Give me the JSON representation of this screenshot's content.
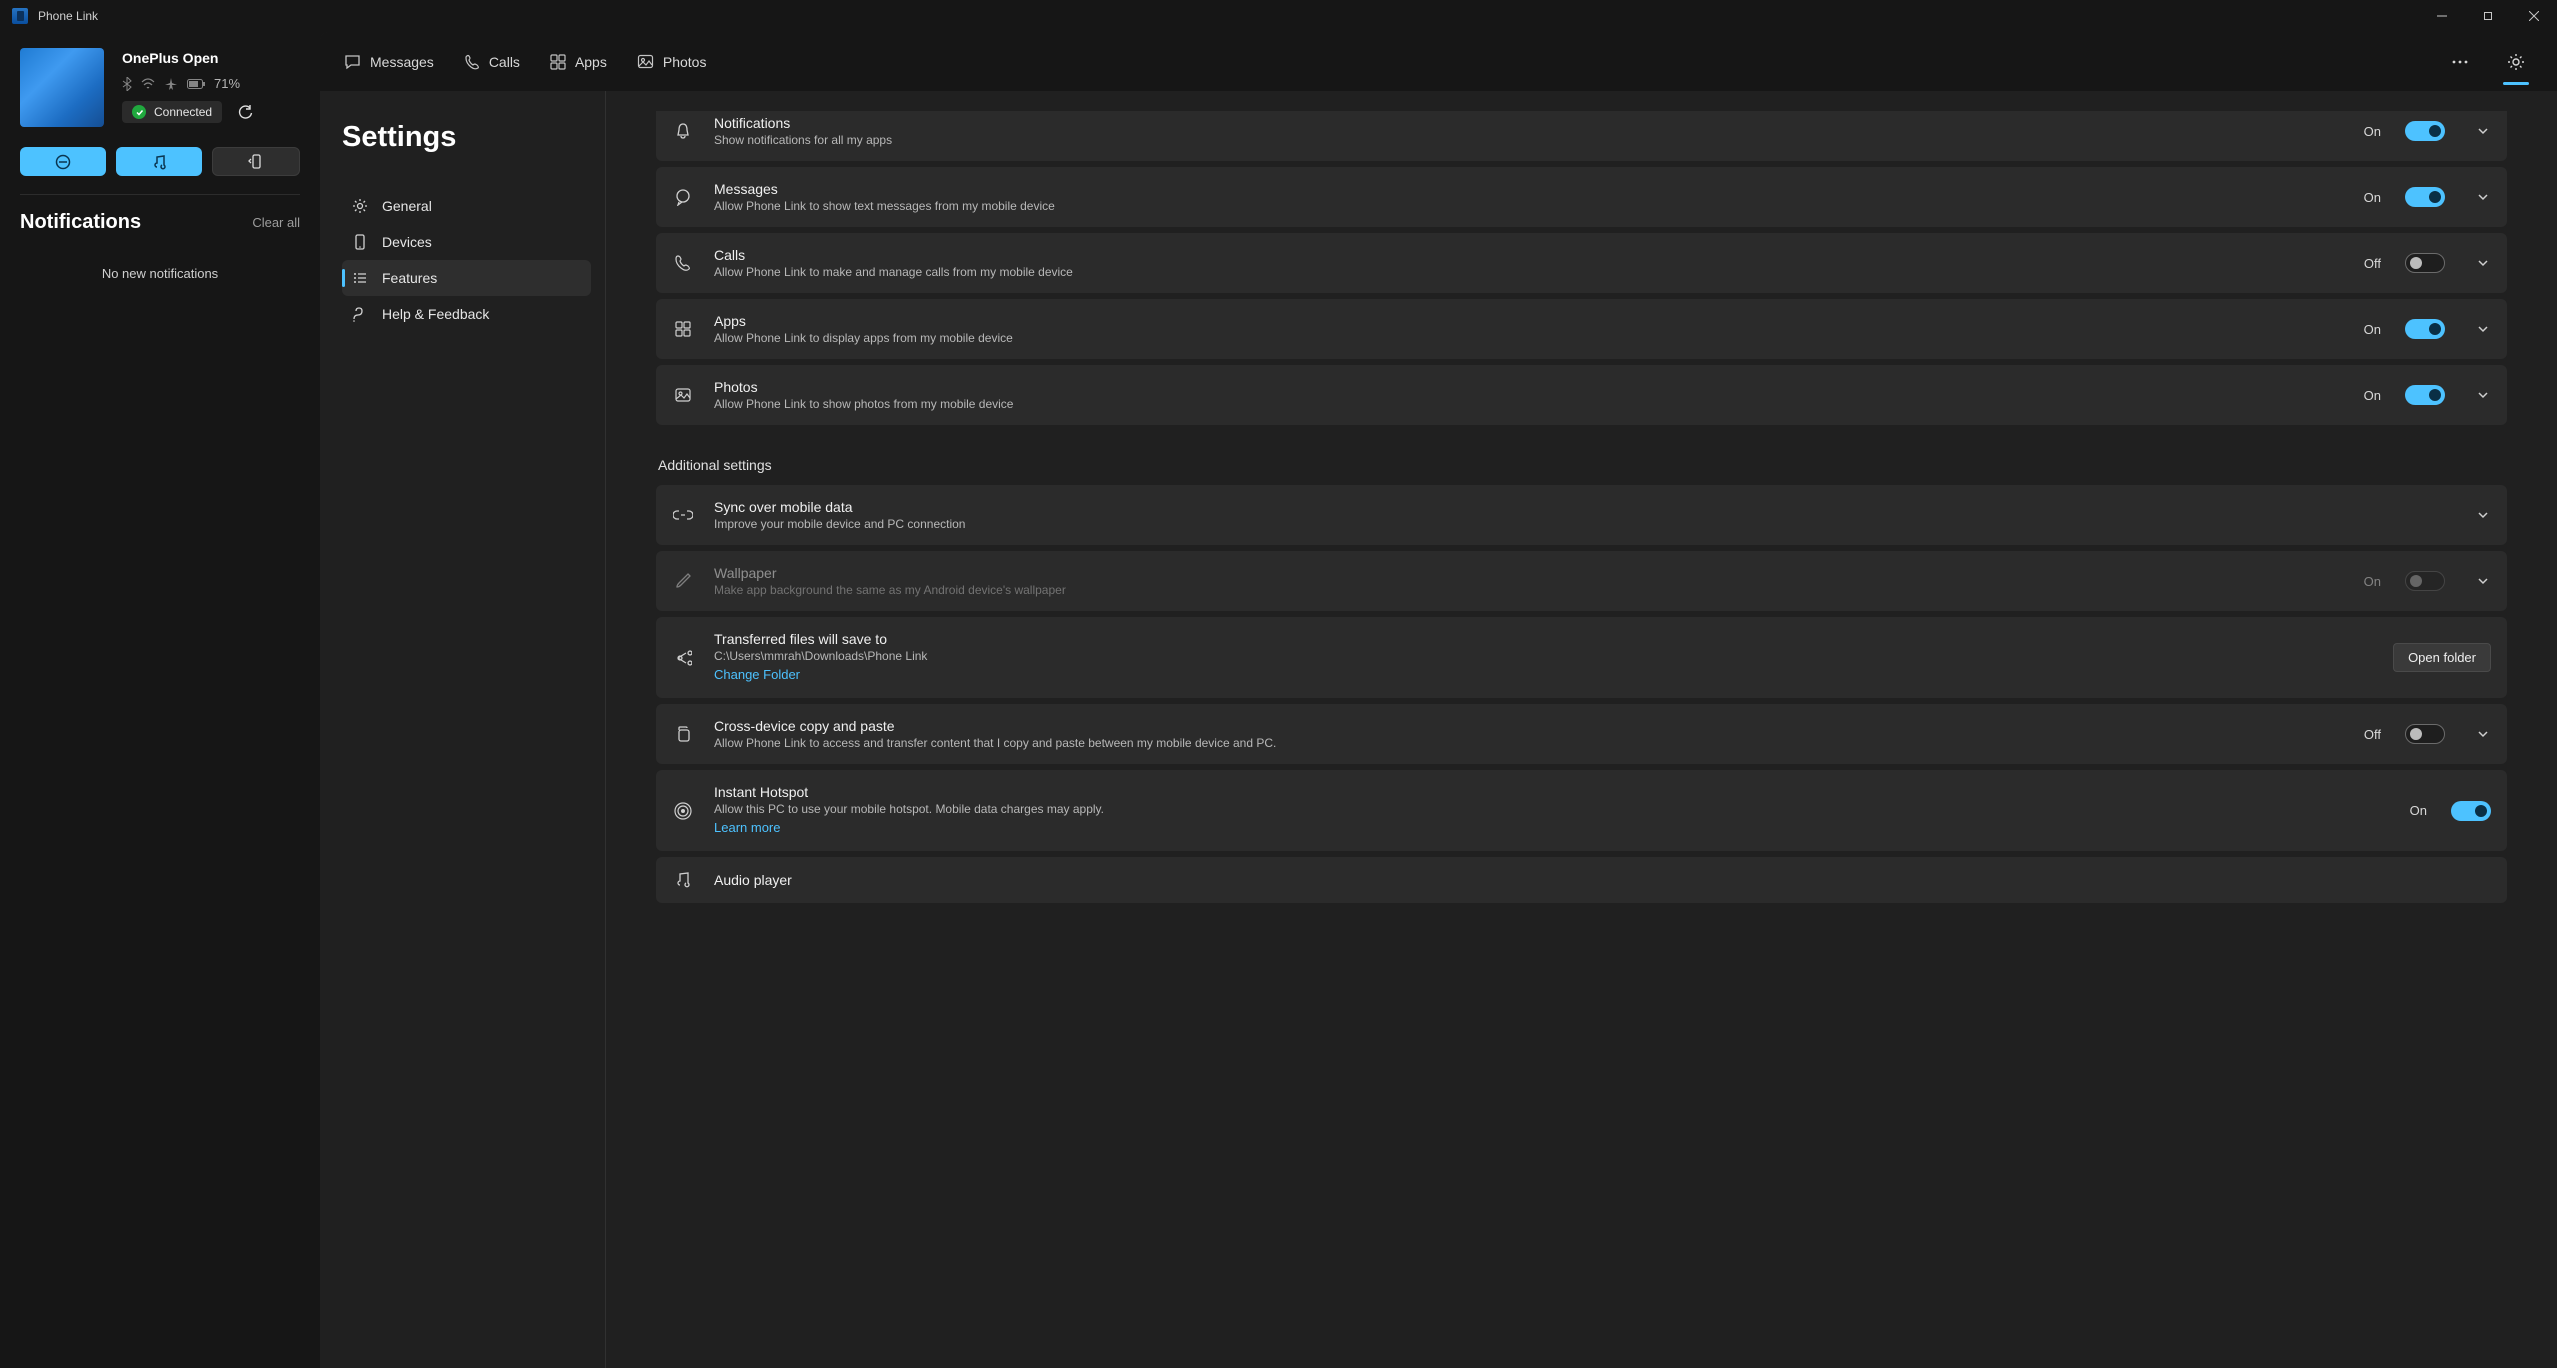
{
  "app": {
    "title": "Phone Link"
  },
  "device": {
    "name": "OnePlus Open",
    "battery": "71%",
    "status_label": "Connected"
  },
  "sidebar": {
    "notifications_heading": "Notifications",
    "clear_all": "Clear all",
    "empty_text": "No new notifications"
  },
  "nav": {
    "messages": "Messages",
    "calls": "Calls",
    "apps": "Apps",
    "photos": "Photos"
  },
  "settings": {
    "title": "Settings",
    "items": [
      {
        "label": "General"
      },
      {
        "label": "Devices"
      },
      {
        "label": "Features"
      },
      {
        "label": "Help & Feedback"
      }
    ],
    "additional_label": "Additional settings",
    "rows": {
      "notifications": {
        "title": "Notifications",
        "sub": "Show notifications for all my apps",
        "state": "On"
      },
      "messages": {
        "title": "Messages",
        "sub": "Allow Phone Link to show text messages from my mobile device",
        "state": "On"
      },
      "calls": {
        "title": "Calls",
        "sub": "Allow Phone Link to make and manage calls from my mobile device",
        "state": "Off"
      },
      "apps": {
        "title": "Apps",
        "sub": "Allow Phone Link to display apps from my mobile device",
        "state": "On"
      },
      "photos": {
        "title": "Photos",
        "sub": "Allow Phone Link to show photos from my mobile device",
        "state": "On"
      },
      "sync": {
        "title": "Sync over mobile data",
        "sub": "Improve your mobile device and PC connection"
      },
      "wallpaper": {
        "title": "Wallpaper",
        "sub": "Make app background the same as my Android device's wallpaper",
        "state": "On"
      },
      "transfer": {
        "title": "Transferred files will save to",
        "sub": "C:\\Users\\mmrah\\Downloads\\Phone Link",
        "link": "Change Folder",
        "button": "Open folder"
      },
      "clipboard": {
        "title": "Cross-device copy and paste",
        "sub": "Allow Phone Link to access and transfer content that I copy and paste between my mobile device and PC.",
        "state": "Off"
      },
      "hotspot": {
        "title": "Instant Hotspot",
        "sub": "Allow this PC to use your mobile hotspot. Mobile data charges may apply.",
        "link": "Learn more",
        "state": "On"
      },
      "audio": {
        "title": "Audio player"
      }
    }
  }
}
